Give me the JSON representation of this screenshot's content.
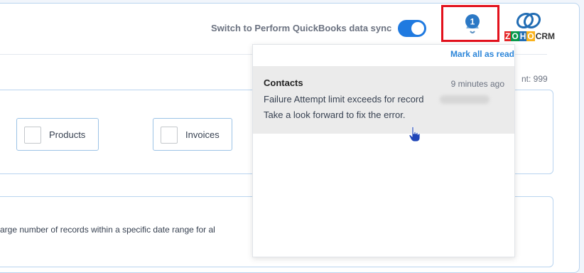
{
  "header": {
    "sync_label": "Switch to Perform QuickBooks data sync",
    "sync_enabled": true,
    "notification_count": "1",
    "logo": {
      "letters": [
        "Z",
        "O",
        "H",
        "O"
      ],
      "suffix": "CRM"
    }
  },
  "main": {
    "count_text": "nt: 999",
    "modules": [
      {
        "label": "Products",
        "checked": false
      },
      {
        "label": "Invoices",
        "checked": false
      }
    ],
    "range_text": "arge number of records within a specific date range for al"
  },
  "notifications": {
    "mark_all_label": "Mark all as read",
    "items": [
      {
        "title": "Contacts",
        "time": "9 minutes ago",
        "message_line1": "Failure Attempt limit exceeds for record",
        "message_line2": "Take a look forward to fix the error."
      }
    ]
  },
  "colors": {
    "accent": "#1f7ae0",
    "highlight_border": "#e3111c",
    "link": "#2d86d9",
    "card_border": "#b9d4ef"
  },
  "icons": [
    "bell-icon",
    "zoho-logo",
    "checkbox",
    "hand-cursor-icon"
  ]
}
